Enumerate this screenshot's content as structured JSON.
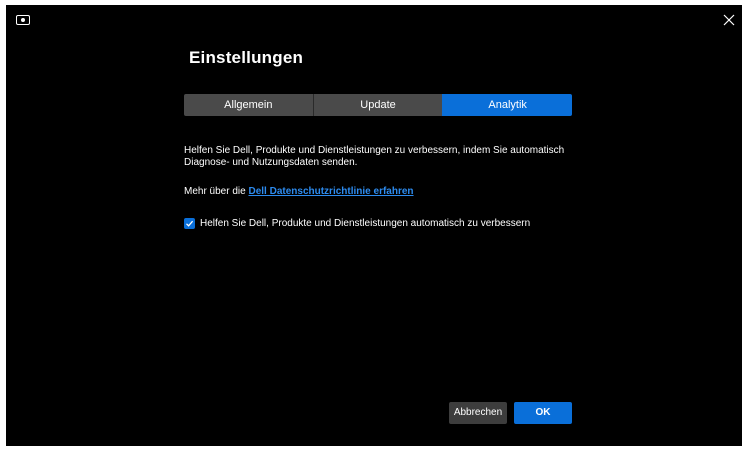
{
  "window": {
    "app_icon": "monitor-icon",
    "close_icon": "close-icon"
  },
  "header": {
    "title": "Einstellungen"
  },
  "tabs": [
    {
      "label": "Allgemein",
      "active": false
    },
    {
      "label": "Update",
      "active": false
    },
    {
      "label": "Analytik",
      "active": true
    }
  ],
  "analytics": {
    "description_line1": "Helfen Sie Dell, Produkte und Dienstleistungen zu verbessern, indem Sie automatisch",
    "description_line2": "Diagnose- und Nutzungsdaten senden.",
    "privacy_prefix": "Mehr über die ",
    "privacy_link": "Dell Datenschutzrichtlinie erfahren",
    "checkbox_label": "Helfen Sie Dell, Produkte und Dienstleistungen automatisch zu verbessern",
    "checkbox_checked": true
  },
  "footer": {
    "cancel_label": "Abbrechen",
    "ok_label": "OK"
  },
  "colors": {
    "background": "#000000",
    "accent": "#0a6fd9",
    "tab_inactive": "#4a4a4a",
    "link": "#2d8cf0",
    "button_secondary": "#3d3d3d"
  }
}
